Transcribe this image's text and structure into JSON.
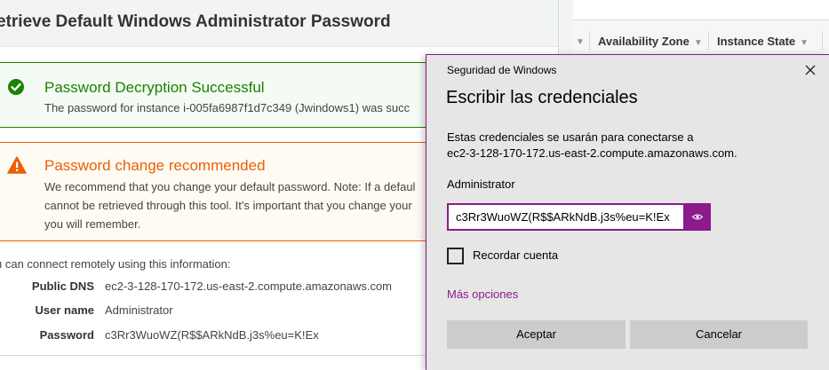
{
  "aws": {
    "page_title": "etrieve Default Windows Administrator Password",
    "table_columns": [
      "Availability Zone",
      "Instance State"
    ],
    "success_alert": {
      "title": "Password Decryption Successful",
      "text": "The password for instance i-005fa6987f1d7c349 (Jwindows1) was succ"
    },
    "warning_alert": {
      "title": "Password change recommended",
      "lines": [
        "We recommend that you change your default password. Note: If a defaul",
        "cannot be retrieved through this tool. It's important that you change your",
        "you will remember."
      ]
    },
    "info_intro": "u can connect remotely using this information:",
    "info": {
      "public_dns_label": "Public DNS",
      "public_dns_value": "ec2-3-128-170-172.us-east-2.compute.amazonaws.com",
      "user_name_label": "User name",
      "user_name_value": "Administrator",
      "password_label": "Password",
      "password_value": "c3Rr3WuoWZ(R$$ARkNdB.j3s%eu=K!Ex"
    },
    "colors": {
      "success": "#1d8102",
      "warning": "#eb5f07"
    }
  },
  "dialog": {
    "window_title": "Seguridad de Windows",
    "heading": "Escribir las credenciales",
    "description_lines": [
      "Estas credenciales se usarán para conectarse a",
      "ec2-3-128-170-172.us-east-2.compute.amazonaws.com."
    ],
    "username": "Administrator",
    "password_value": "c3Rr3WuoWZ(R$$ARkNdB.j3s%eu=K!Ex",
    "remember_label": "Recordar cuenta",
    "remember_checked": false,
    "more_options": "Más opciones",
    "ok_label": "Aceptar",
    "cancel_label": "Cancelar",
    "accent_color": "#8b1a8b"
  }
}
